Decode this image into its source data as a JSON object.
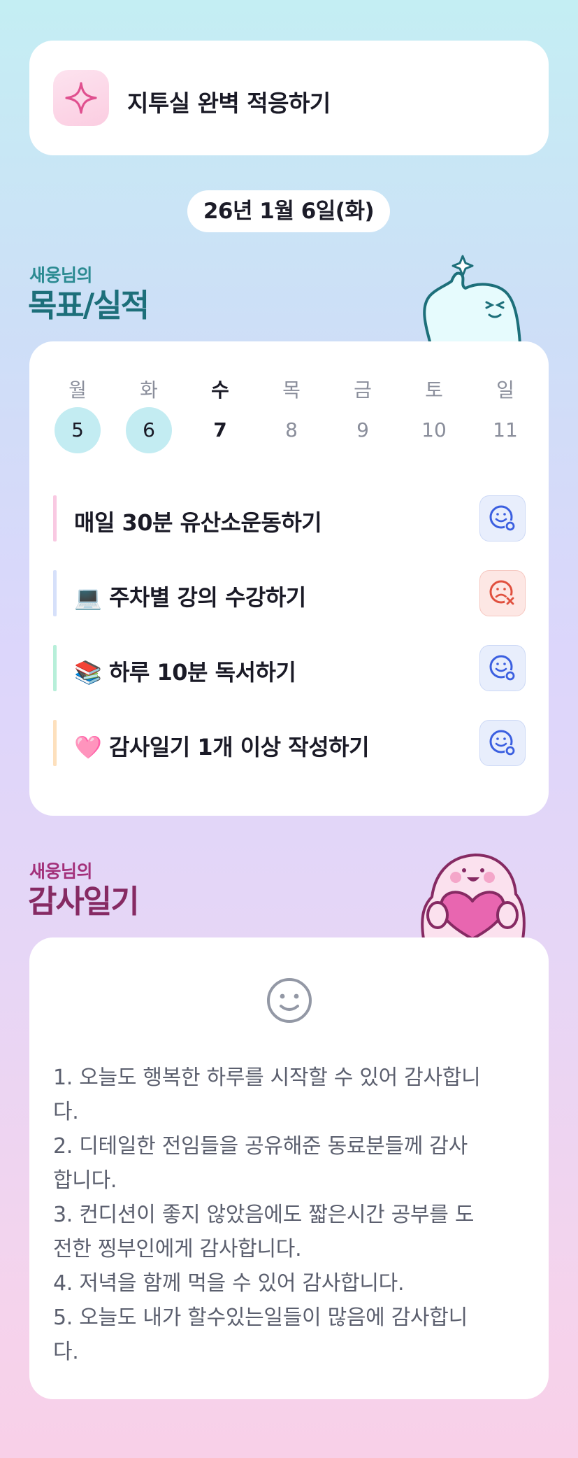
{
  "header": {
    "title": "지투실 완벽 적응하기",
    "icon": "sparkle-icon"
  },
  "date_label": "26년 1월 6일(화)",
  "goals_section": {
    "subtitle": "새웅님의",
    "title": "목표/실적"
  },
  "week": {
    "days": [
      {
        "name": "월",
        "num": "5",
        "state": "done"
      },
      {
        "name": "화",
        "num": "6",
        "state": "done"
      },
      {
        "name": "수",
        "num": "7",
        "state": "today"
      },
      {
        "name": "목",
        "num": "8",
        "state": "future"
      },
      {
        "name": "금",
        "num": "9",
        "state": "future"
      },
      {
        "name": "토",
        "num": "10",
        "state": "future"
      },
      {
        "name": "일",
        "num": "11",
        "state": "future"
      }
    ]
  },
  "goals": [
    {
      "label": "매일 30분 유산소운동하기",
      "status": "success",
      "bar_color": "#f9c9e2"
    },
    {
      "label": "💻 주차별 강의 수강하기",
      "status": "fail",
      "bar_color": "#d6e0fa"
    },
    {
      "label": "📚 하루 10분 독서하기",
      "status": "success",
      "bar_color": "#b7efd9"
    },
    {
      "label": "🩷 감사일기 1개 이상 작성하기",
      "status": "success",
      "bar_color": "#fde0bd"
    }
  ],
  "diary_section": {
    "subtitle": "새웅님의",
    "title": "감사일기"
  },
  "diary": {
    "mood_icon": "smile-face-icon",
    "lines": [
      "1. 오늘도 행복한 하루를 시작할 수 있어 감사합니",
      "다.",
      "2. 디테일한 전임들을 공유해준 동료분들께 감사",
      "합니다.",
      "3. 컨디션이 좋지 않았음에도 짧은시간 공부를 도",
      "전한 찡부인에게 감사합니다.",
      "4. 저녁을 함께 먹을 수 있어 감사합니다.",
      "5. 오늘도 내가 할수있는일들이 많음에 감사합니",
      "다."
    ]
  },
  "colors": {
    "success_icon": "#3b5fe0",
    "fail_icon": "#e0503e",
    "teal_title": "#1d6f7a",
    "purple_title": "#862a63"
  }
}
